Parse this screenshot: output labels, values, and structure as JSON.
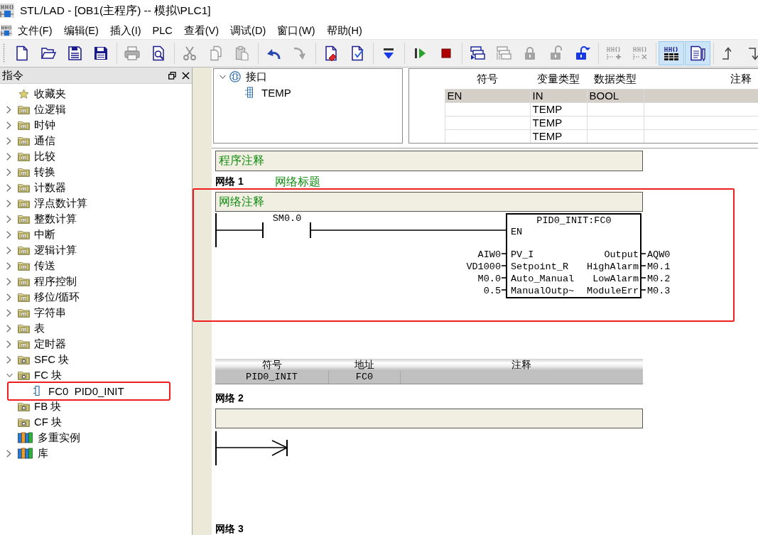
{
  "window": {
    "title": "STL/LAD - [OB1(主程序) -- 模拟\\PLC1]"
  },
  "menu": [
    "文件(F)",
    "编辑(E)",
    "插入(I)",
    "PLC",
    "查看(V)",
    "调试(D)",
    "窗口(W)",
    "帮助(H)"
  ],
  "toolbar": [
    {
      "buttons": [
        {
          "disabled": false
        },
        {
          "disabled": false
        },
        {
          "disabled": false
        },
        {
          "disabled": false
        }
      ]
    },
    {
      "buttons": [
        {
          "disabled": true
        },
        {
          "disabled": false
        }
      ]
    },
    {
      "buttons": [
        {
          "disabled": true
        },
        {
          "disabled": true
        },
        {
          "disabled": true
        }
      ]
    },
    {
      "buttons": [
        {
          "disabled": false
        },
        {
          "disabled": true
        }
      ]
    },
    {
      "buttons": [
        {
          "disabled": false
        },
        {
          "disabled": false
        }
      ]
    },
    {
      "buttons": [
        {
          "disabled": false
        }
      ]
    },
    {
      "buttons": [
        {
          "disabled": false
        },
        {
          "disabled": false
        }
      ]
    },
    {
      "buttons": [
        {
          "disabled": false
        },
        {
          "disabled": true
        },
        {
          "disabled": true
        },
        {
          "disabled": true
        },
        {
          "disabled": false
        }
      ]
    },
    {
      "buttons": [
        {
          "disabled": true
        },
        {
          "disabled": true
        }
      ]
    },
    {
      "buttons": [
        {
          "disabled": false,
          "selected": true
        },
        {
          "disabled": false,
          "selected": true
        }
      ]
    },
    {
      "buttons": [
        {
          "disabled": false
        },
        {
          "disabled": false
        }
      ]
    }
  ],
  "instructions": {
    "title": "指令",
    "items": [
      {
        "label": "收藏夹",
        "kind": "favorites"
      },
      {
        "label": "位逻辑",
        "kind": "folder",
        "expanded": false
      },
      {
        "label": "时钟",
        "kind": "folder",
        "expanded": false
      },
      {
        "label": "通信",
        "kind": "folder",
        "expanded": false
      },
      {
        "label": "比较",
        "kind": "folder",
        "expanded": false
      },
      {
        "label": "转换",
        "kind": "folder",
        "expanded": false
      },
      {
        "label": "计数器",
        "kind": "folder",
        "expanded": false
      },
      {
        "label": "浮点数计算",
        "kind": "folder",
        "expanded": false
      },
      {
        "label": "整数计算",
        "kind": "folder",
        "expanded": false
      },
      {
        "label": "中断",
        "kind": "folder",
        "expanded": false
      },
      {
        "label": "逻辑计算",
        "kind": "folder",
        "expanded": false
      },
      {
        "label": "传送",
        "kind": "folder",
        "expanded": false
      },
      {
        "label": "程序控制",
        "kind": "folder",
        "expanded": false
      },
      {
        "label": "移位/循环",
        "kind": "folder",
        "expanded": false
      },
      {
        "label": "字符串",
        "kind": "folder",
        "expanded": false
      },
      {
        "label": "表",
        "kind": "folder",
        "expanded": false
      },
      {
        "label": "定时器",
        "kind": "folder",
        "expanded": false
      },
      {
        "label": "SFC 块",
        "kind": "block_folder",
        "expanded": false
      },
      {
        "label": "FC 块",
        "kind": "block_folder",
        "expanded": true,
        "children": [
          {
            "label": "FC0  PID0_INIT",
            "kind": "block",
            "highlighted": true
          }
        ]
      },
      {
        "label": "FB 块",
        "kind": "block_folder"
      },
      {
        "label": "CF 块",
        "kind": "block_folder"
      },
      {
        "label": "多重实例",
        "kind": "instances"
      },
      {
        "label": "库",
        "kind": "library",
        "expanded": false
      }
    ]
  },
  "interface": {
    "tree": [
      {
        "label": "接口",
        "expanded": true,
        "children": [
          {
            "label": "TEMP"
          }
        ]
      }
    ],
    "table": {
      "columns": [
        "符号",
        "变量类型",
        "数据类型",
        "注释"
      ],
      "rows": [
        {
          "symbol": "EN",
          "var_type": "IN",
          "data_type": "BOOL",
          "selected": true
        },
        {
          "var_type": "TEMP",
          "selected": false
        },
        {
          "var_type": "TEMP",
          "selected": false
        },
        {
          "var_type": "TEMP",
          "selected": false
        }
      ]
    }
  },
  "program_comment": "程序注释",
  "networks": [
    {
      "label": "网络 1",
      "title": "网络标题",
      "comment": "网络注释",
      "highlighted": true,
      "rung": {
        "kind": "logic",
        "contact": {
          "address": "SM0.0"
        },
        "block": {
          "title": "PID0_INIT:FC0",
          "enable": "EN",
          "inputs": [
            {
              "pin": "PV_I",
              "operand": "AIW0"
            },
            {
              "pin": "Setpoint_R",
              "operand": "VD1000"
            },
            {
              "pin": "Auto_Manual",
              "operand": "M0.0"
            },
            {
              "pin": "ManualOutp~",
              "operand": "0.5"
            }
          ],
          "outputs": [
            {
              "pin": "Output",
              "operand": "AQW0"
            },
            {
              "pin": "HighAlarm",
              "operand": "M0.1"
            },
            {
              "pin": "LowAlarm",
              "operand": "M0.2"
            },
            {
              "pin": "ModuleErr",
              "operand": "M0.3"
            }
          ]
        }
      },
      "symbols": {
        "columns": [
          "符号",
          "地址",
          "注释"
        ],
        "rows": [
          {
            "cells": [
              "PID0_INIT",
              "FC0"
            ]
          }
        ]
      }
    },
    {
      "label": "网络 2",
      "highlighted": false,
      "rung": {
        "kind": "open"
      }
    },
    {
      "label": "网络 3",
      "highlighted": false
    }
  ]
}
